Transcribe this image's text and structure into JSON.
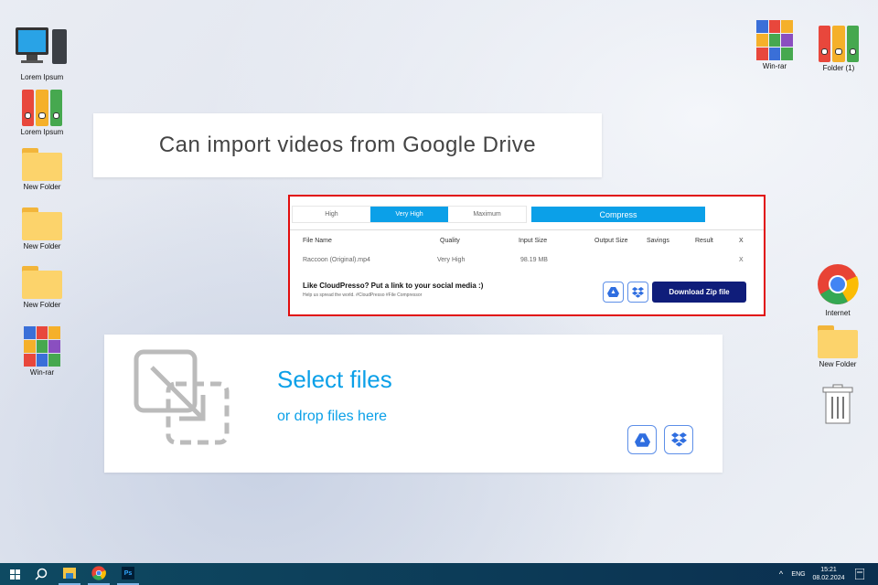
{
  "desktop": {
    "left_icons": [
      {
        "label": "Lorem Ipsum",
        "icon": "computer-icon"
      },
      {
        "label": "Lorem Ipsum",
        "icon": "binders-icon"
      },
      {
        "label": "New Folder",
        "icon": "folder-icon"
      },
      {
        "label": "New Folder",
        "icon": "folder-icon"
      },
      {
        "label": "New Folder",
        "icon": "folder-icon"
      },
      {
        "label": "Win-rar",
        "icon": "winrar-icon"
      }
    ],
    "right_icons": [
      {
        "label": "Win-rar"
      },
      {
        "label": "Folder (1)"
      },
      {
        "label": "Internet"
      },
      {
        "label": "New Folder"
      }
    ]
  },
  "caption": "Can import videos from Google Drive",
  "panel": {
    "tabs": [
      "High",
      "Very High",
      "Maximum"
    ],
    "active_tab": "Very High",
    "compress": "Compress",
    "headers": [
      "File Name",
      "Quality",
      "Input Size",
      "Output Size",
      "Savings",
      "Result",
      "X"
    ],
    "rows": [
      {
        "name": "Raccoon (Original).mp4",
        "quality": "Very High",
        "input": "98.19 MB",
        "remove": "X"
      }
    ],
    "promo_title": "Like CloudPresso? Put a link to your social media :)",
    "promo_sub": "Help us spread the world. #CloudPresso #File Compressor",
    "download": "Download Zip file"
  },
  "drop": {
    "title": "Select files",
    "sub": "or drop files here"
  },
  "taskbar": {
    "lang": "ENG",
    "time": "15:21",
    "date": "08.02.2024"
  },
  "colors": {
    "accent": "#0ba0e8",
    "download": "#0f1d7a",
    "border": "#e10d0d",
    "taskbar": "#0b2f4f"
  }
}
